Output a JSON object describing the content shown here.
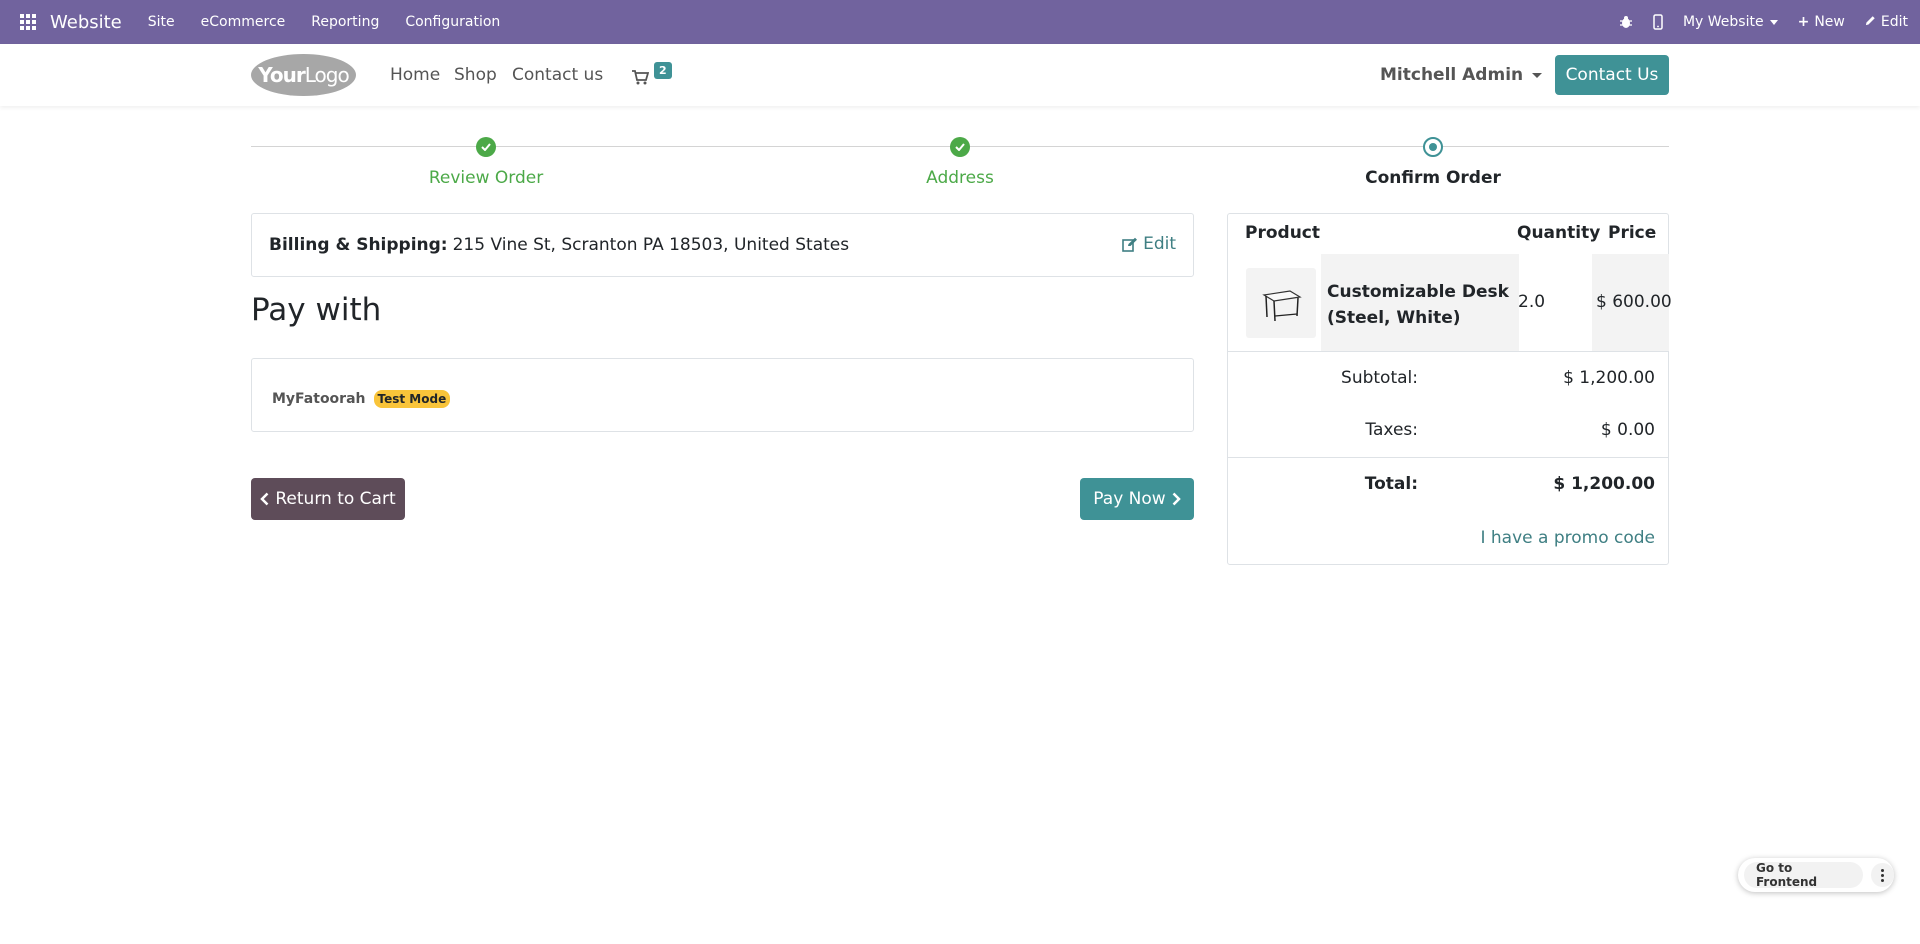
{
  "adminbar": {
    "app_name": "Website",
    "menus": [
      "Site",
      "eCommerce",
      "Reporting",
      "Configuration"
    ],
    "website_selector": "My Website",
    "new_label": "New",
    "edit_label": "Edit",
    "color": "#71639e"
  },
  "header": {
    "logo_text_bold": "Your",
    "logo_text": "Logo",
    "nav": [
      "Home",
      "Shop",
      "Contact us"
    ],
    "cart_count": "2",
    "user_name": "Mitchell Admin",
    "contact_button": "Contact Us"
  },
  "steps": [
    {
      "label": "Review Order",
      "state": "done"
    },
    {
      "label": "Address",
      "state": "done"
    },
    {
      "label": "Confirm Order",
      "state": "current"
    }
  ],
  "billing": {
    "label": "Billing & Shipping:",
    "address": "215 Vine St, Scranton PA 18503, United States",
    "edit_label": "Edit"
  },
  "payment": {
    "title": "Pay with",
    "option_name": "MyFatoorah",
    "option_badge": "Test Mode"
  },
  "actions": {
    "return_label": "Return to Cart",
    "pay_label": "Pay Now"
  },
  "summary": {
    "headers": {
      "product": "Product",
      "quantity": "Quantity",
      "price": "Price"
    },
    "product": {
      "name": "Customizable Desk (Steel, White)",
      "quantity": "2.0",
      "price": "$ 600.00"
    },
    "subtotal_label": "Subtotal:",
    "subtotal_value": "$ 1,200.00",
    "taxes_label": "Taxes:",
    "taxes_value": "$ 0.00",
    "total_label": "Total:",
    "total_value": "$ 1,200.00",
    "promo_label": "I have a promo code"
  },
  "floating": {
    "go_frontend": "Go to Frontend"
  },
  "colors": {
    "primary": "#3f9296",
    "success": "#4ca948",
    "secondary": "#5e4c59",
    "warning_badge": "#f9c43a"
  }
}
